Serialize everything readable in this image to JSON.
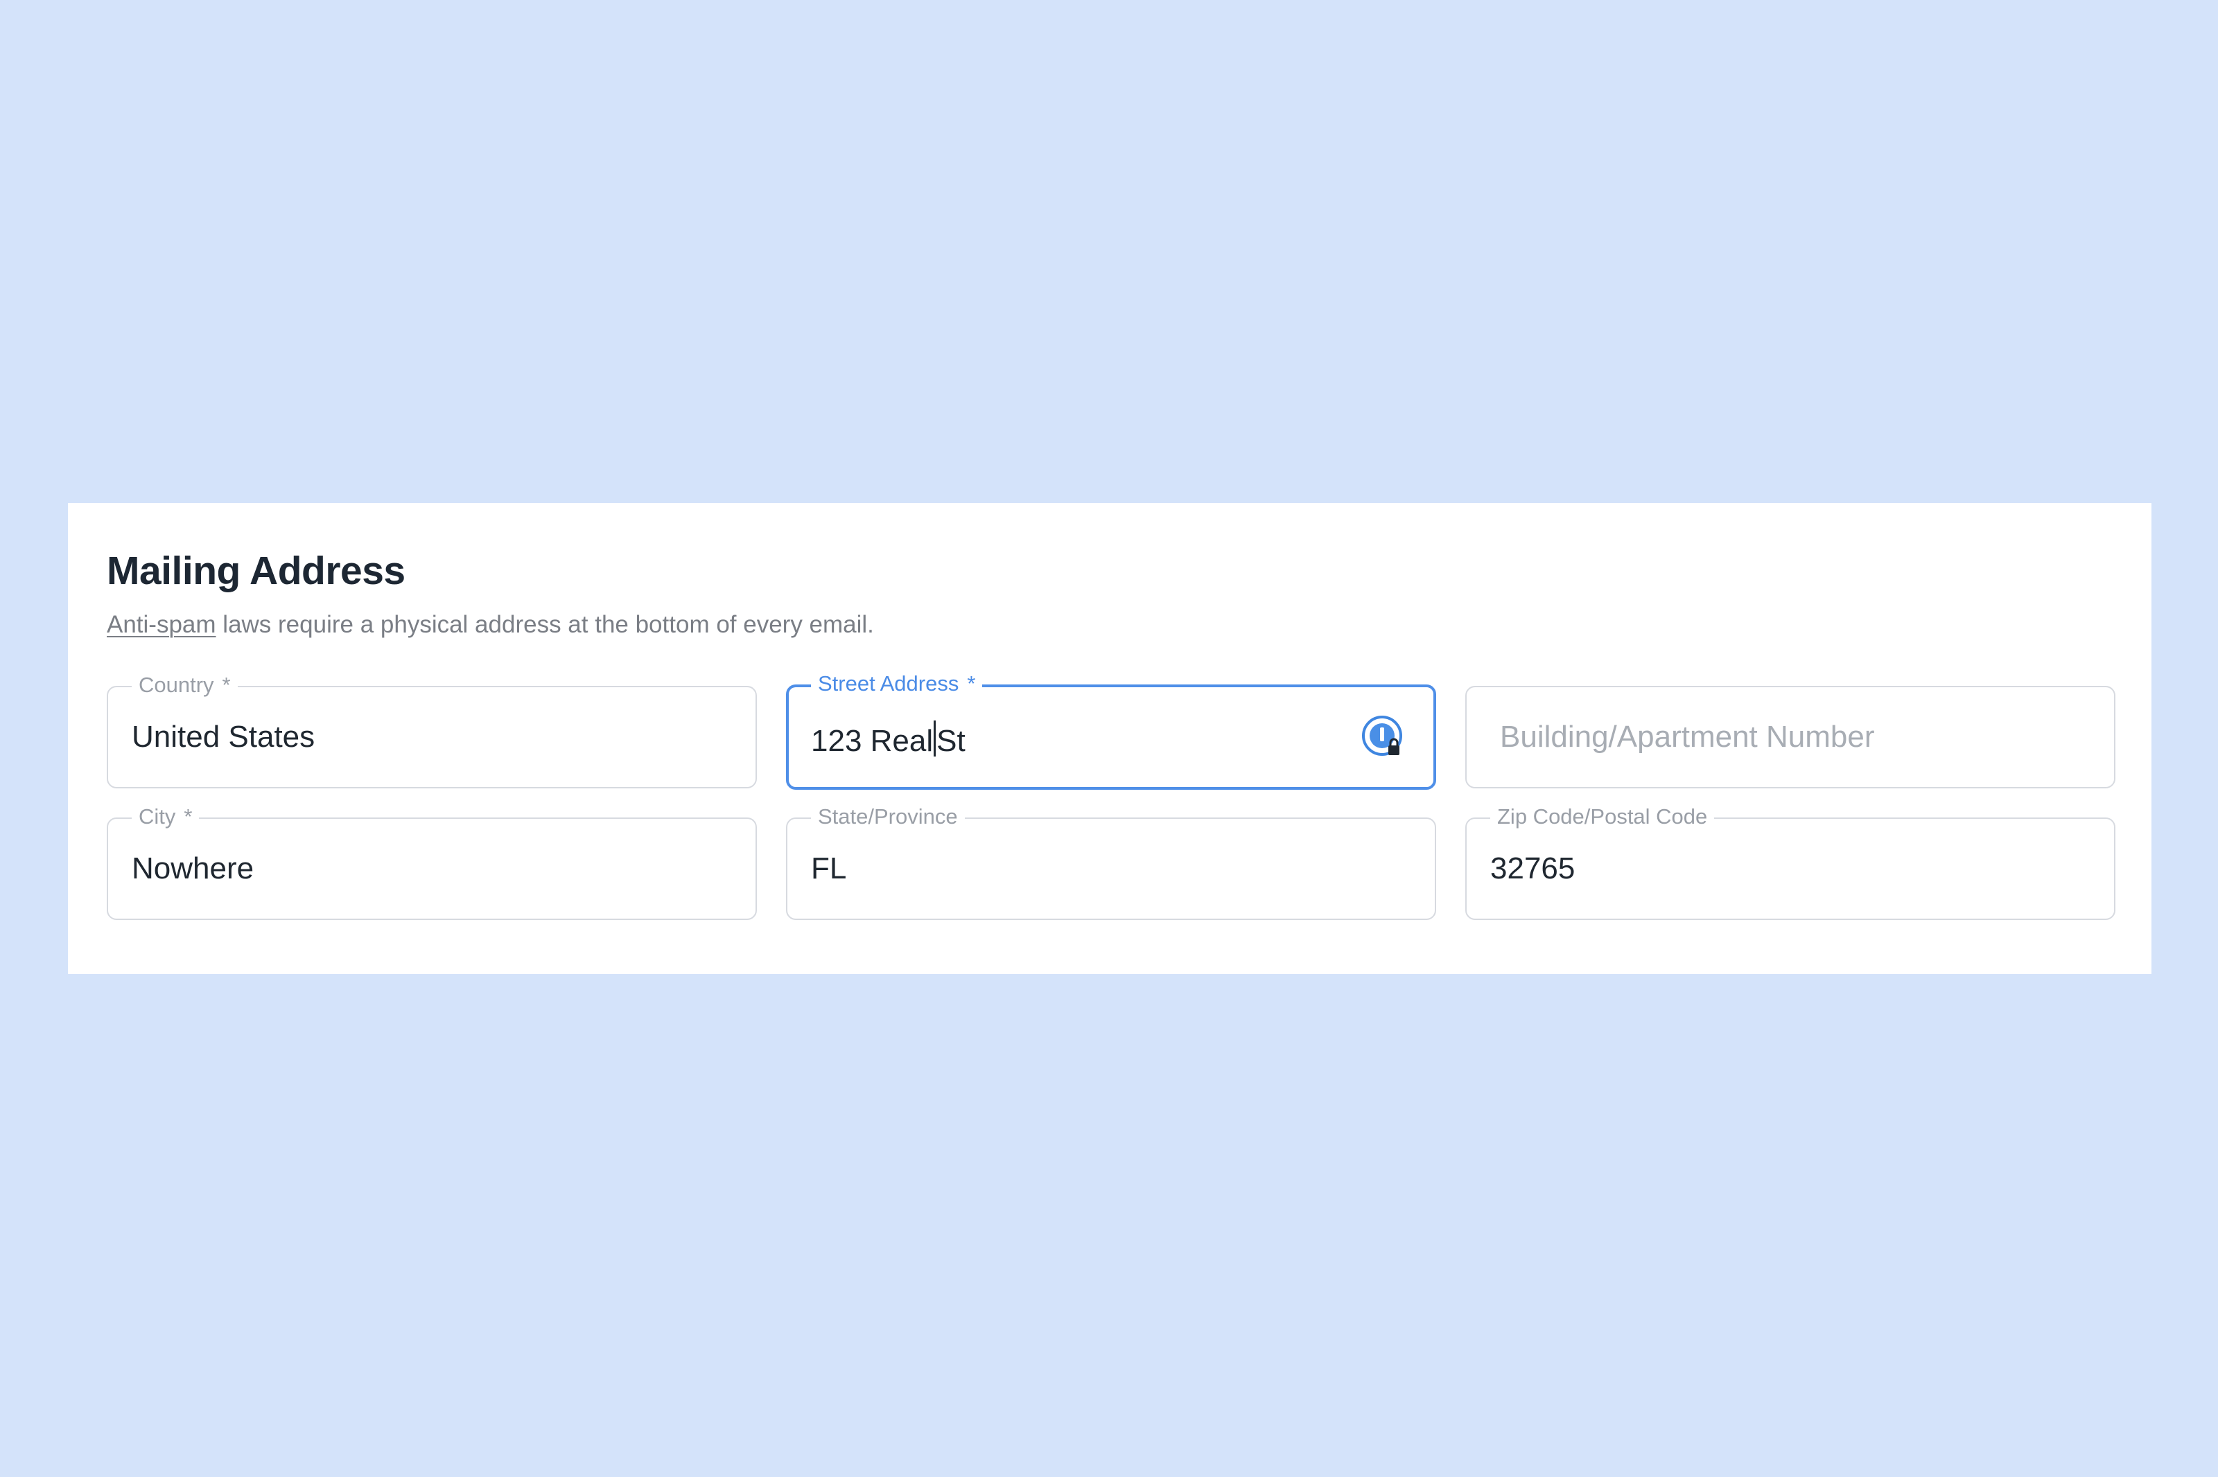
{
  "section": {
    "title": "Mailing Address",
    "subtitle_link": "Anti-spam",
    "subtitle_rest": " laws require a physical address at the bottom of every email."
  },
  "fields": {
    "country": {
      "label": "Country",
      "required": "*",
      "value": "United States"
    },
    "street": {
      "label": "Street Address",
      "required": "*",
      "value_before_caret": "123 Real",
      "value_after_caret": "St"
    },
    "building": {
      "placeholder": "Building/Apartment Number"
    },
    "city": {
      "label": "City",
      "required": "*",
      "value": "Nowhere"
    },
    "state": {
      "label": "State/Province",
      "value": "FL"
    },
    "zip": {
      "label": "Zip Code/Postal Code",
      "value": "32765"
    }
  },
  "icons": {
    "password_manager": "password-manager-lock-icon"
  },
  "colors": {
    "background": "#d4e3fa",
    "focus_accent": "#4f8fe8",
    "title": "#1d2733"
  }
}
